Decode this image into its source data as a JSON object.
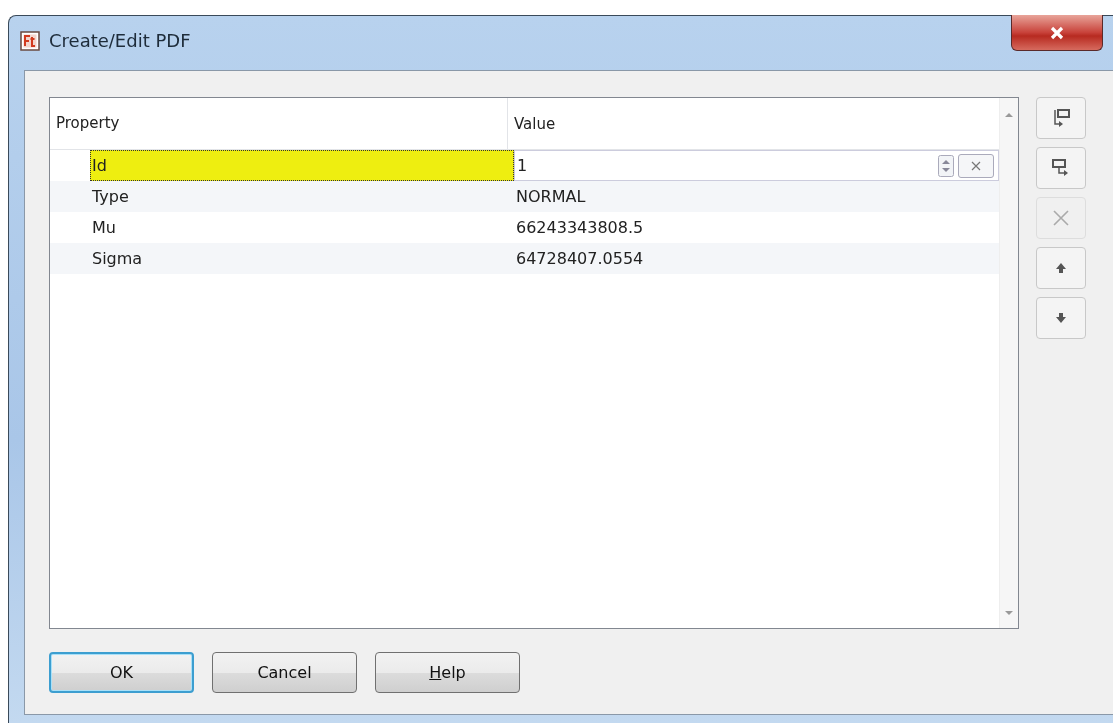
{
  "window": {
    "title": "Create/Edit PDF"
  },
  "table": {
    "columns": [
      "Property",
      "Value"
    ],
    "rows": [
      {
        "property": "Id",
        "value": "1",
        "selected": true
      },
      {
        "property": "Type",
        "value": "NORMAL",
        "selected": false
      },
      {
        "property": "Mu",
        "value": "66243343808.5",
        "selected": false
      },
      {
        "property": "Sigma",
        "value": "64728407.0554",
        "selected": false
      }
    ]
  },
  "side_buttons": [
    {
      "kind": "insert-before",
      "disabled": false
    },
    {
      "kind": "insert-after",
      "disabled": false
    },
    {
      "kind": "delete",
      "disabled": true
    },
    {
      "kind": "up",
      "disabled": false
    },
    {
      "kind": "down",
      "disabled": false
    }
  ],
  "buttons": [
    {
      "label": "OK",
      "default": true,
      "underline_first": false
    },
    {
      "label": "Cancel",
      "default": false,
      "underline_first": false
    },
    {
      "label": "Help",
      "default": false,
      "underline_first": true
    }
  ]
}
